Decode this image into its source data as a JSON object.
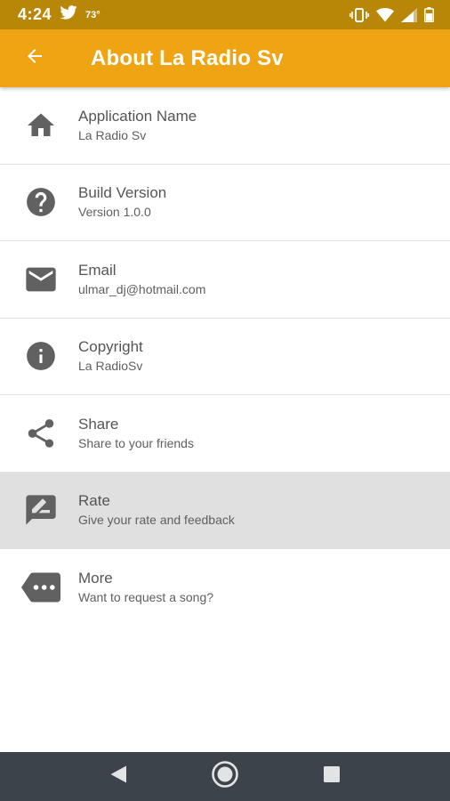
{
  "status_bar": {
    "time": "4:24",
    "temperature": "73°",
    "left_icons": [
      "twitter-icon"
    ],
    "right_icons": [
      "vibrate-icon",
      "wifi-icon",
      "signal-icon",
      "battery-icon"
    ]
  },
  "app_bar": {
    "title": "About La Radio Sv",
    "background_color": "#efa413",
    "back_icon": "arrow-back-icon"
  },
  "items": [
    {
      "icon": "home-icon",
      "title": "Application Name",
      "subtitle": "La Radio Sv"
    },
    {
      "icon": "help-icon",
      "title": "Build Version",
      "subtitle": "Version 1.0.0"
    },
    {
      "icon": "mail-icon",
      "title": "Email",
      "subtitle": "ulmar_dj@hotmail.com"
    },
    {
      "icon": "info-icon",
      "title": "Copyright",
      "subtitle": "La RadioSv"
    },
    {
      "icon": "share-icon",
      "title": "Share",
      "subtitle": "Share to your friends"
    },
    {
      "icon": "rate-review-icon",
      "title": "Rate",
      "subtitle": "Give your rate and feedback",
      "pressed": true
    },
    {
      "icon": "more-icon",
      "title": "More",
      "subtitle": "Want to request a song?"
    }
  ],
  "nav_bar": {
    "buttons": [
      "back-triangle-icon",
      "home-circle-icon",
      "recents-square-icon"
    ]
  }
}
